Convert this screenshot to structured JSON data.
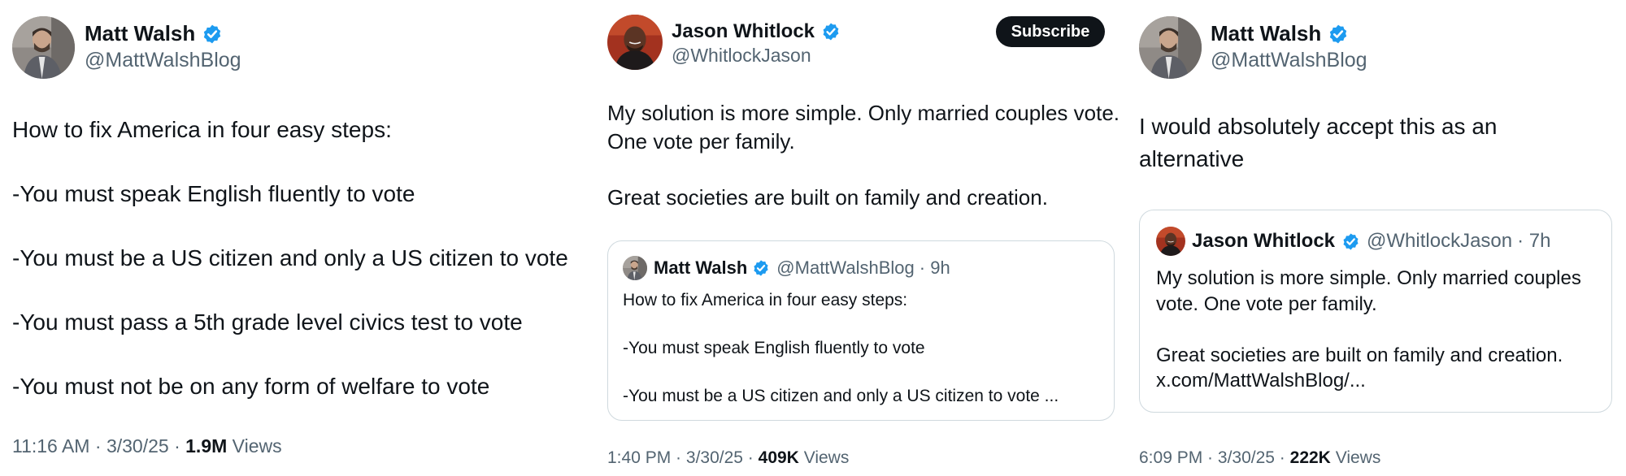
{
  "colors": {
    "verified": "#1d9bf0",
    "text": "#0f1419",
    "secondary": "#536471",
    "border": "#cfd9de"
  },
  "tweets": [
    {
      "author": {
        "name": "Matt Walsh",
        "handle": "@MattWalshBlog",
        "avatar_icon": "person-avatar-icon",
        "verified": true
      },
      "text": "How to fix America in four easy steps:\n\n-You must speak English fluently to vote\n\n-You must be a US citizen and only a US citizen to vote\n\n-You must pass a 5th grade level civics test to vote\n\n-You must not be on any form of welfare to vote",
      "time": "11:16 AM",
      "date": "3/30/25",
      "views_count": "1.9M",
      "views_label": "Views"
    },
    {
      "author": {
        "name": "Jason Whitlock",
        "handle": "@WhitlockJason",
        "avatar_icon": "person-avatar-icon",
        "verified": true
      },
      "subscribe_label": "Subscribe",
      "text": "My solution is more simple. Only married couples vote. One vote per family.\n\nGreat societies are built on family and creation.",
      "quote": {
        "name": "Matt Walsh",
        "handle": "@MattWalshBlog",
        "age": "· 9h",
        "text": "How to fix America in four easy steps:\n\n-You must speak English fluently to vote\n\n-You must be a US citizen and only a US citizen to vote ..."
      },
      "time": "1:40 PM",
      "date": "3/30/25",
      "views_count": "409K",
      "views_label": "Views"
    },
    {
      "author": {
        "name": "Matt Walsh",
        "handle": "@MattWalshBlog",
        "avatar_icon": "person-avatar-icon",
        "verified": true
      },
      "text": "I would absolutely accept this as an alternative",
      "quote": {
        "name": "Jason Whitlock",
        "handle": "@WhitlockJason",
        "age": "· 7h",
        "text": "My solution is more simple. Only married couples vote. One vote per family.\n\nGreat societies are built on family and creation.\nx.com/MattWalshBlog/..."
      },
      "time": "6:09 PM",
      "date": "3/30/25",
      "views_count": "222K",
      "views_label": "Views"
    }
  ]
}
